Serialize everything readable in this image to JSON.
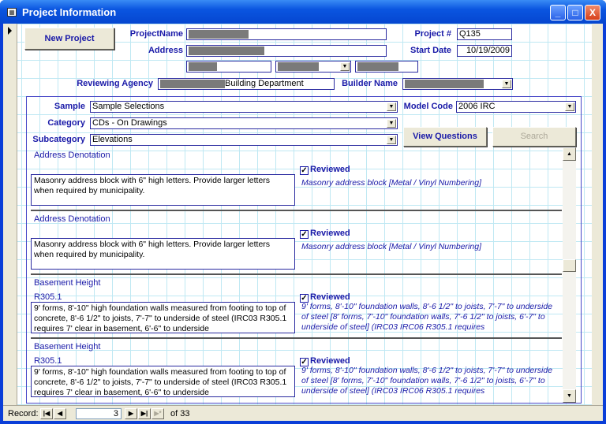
{
  "window": {
    "title": "Project Information",
    "minimize": "_",
    "maximize": "□",
    "close": "X"
  },
  "header": {
    "new_project": "New Project",
    "project_name_label": "ProjectName",
    "address_label": "Address",
    "project_num_label": "Project #",
    "project_num": "Q135",
    "start_date_label": "Start Date",
    "start_date": "10/19/2009",
    "reviewing_agency_label": "Reviewing Agency",
    "reviewing_agency": "Building Department",
    "builder_name_label": "Builder Name"
  },
  "filters": {
    "sample_label": "Sample",
    "sample": "Sample Selections",
    "category_label": "Category",
    "category": "CDs - On Drawings",
    "subcategory_label": "Subcategory",
    "subcategory": "Elevations",
    "model_code_label": "Model Code",
    "model_code": "2006 IRC",
    "view_questions": "View Questions",
    "search": "Search"
  },
  "records": [
    {
      "title": "Address Denotation",
      "code": "",
      "reviewed_label": "Reviewed",
      "reviewed": true,
      "description": "Masonry address block with 6\" high letters. Provide larger letters when required by municipality.",
      "answer": "Masonry address block [Metal / Vinyl Numbering]"
    },
    {
      "title": "Address Denotation",
      "code": "",
      "reviewed_label": "Reviewed",
      "reviewed": true,
      "description": "Masonry address block with 6\" high letters. Provide larger letters when required by municipality.",
      "answer": "Masonry address block [Metal / Vinyl Numbering]"
    },
    {
      "title": "Basement Height",
      "code": "R305.1",
      "reviewed_label": "Reviewed",
      "reviewed": true,
      "description": "9' forms, 8'-10\" high foundation walls measured from footing to top of concrete, 8'-6 1/2\" to joists, 7'-7\" to underside of steel (IRC03 R305.1 requires 7' clear in basement, 6'-6\" to underside",
      "answer": "9' forms, 8'-10\" foundation walls, 8'-6 1/2\" to joists, 7'-7\" to underside of steel [8' forms, 7'-10\" foundation walls, 7'-6 1/2\" to joists, 6'-7\" to underside of steel] (IRC03 IRC06 R305.1 requires"
    },
    {
      "title": "Basement Height",
      "code": "R305.1",
      "reviewed_label": "Reviewed",
      "reviewed": true,
      "description": "9' forms, 8'-10\" high foundation walls measured from footing to top of concrete, 8'-6 1/2\" to joists, 7'-7\" to underside of steel (IRC03 R305.1 requires 7' clear in basement, 6'-6\" to underside",
      "answer": "9' forms, 8'-10\" foundation walls, 8'-6 1/2\" to joists, 7'-7\" to underside of steel [8' forms, 7'-10\" foundation walls, 7'-6 1/2\" to joists, 6'-7\" to underside of steel] (IRC03 IRC06 R305.1 requires"
    }
  ],
  "nav": {
    "record_label": "Record:",
    "current": "3",
    "of_label": "of 33"
  }
}
